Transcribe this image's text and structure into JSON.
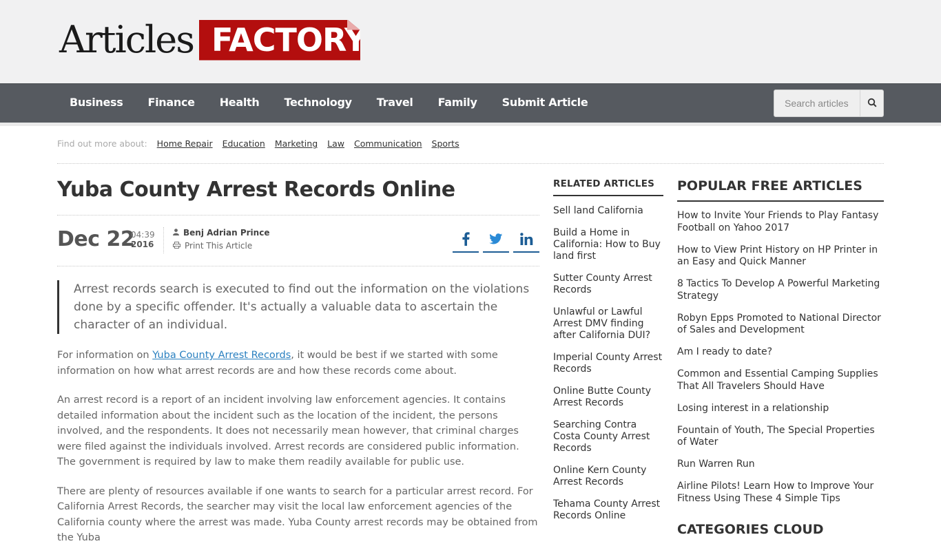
{
  "logo": {
    "articles": "Articles",
    "factory": "FACTORY"
  },
  "nav": {
    "items": [
      "Business",
      "Finance",
      "Health",
      "Technology",
      "Travel",
      "Family",
      "Submit Article"
    ],
    "search_placeholder": "Search articles"
  },
  "topics": {
    "label": "Find out more about:",
    "links": [
      "Home Repair",
      "Education",
      "Marketing",
      "Law",
      "Communication",
      "Sports"
    ]
  },
  "article": {
    "title": "Yuba County Arrest Records Online",
    "date": "Dec 22",
    "time": "04:39",
    "year": "2016",
    "author": "Benj Adrian Prince",
    "print_label": "Print This Article",
    "quote": "Arrest records search is executed to find out the information on the violations done by a specific offender. It's actually a valuable data to ascertain the character of an individual.",
    "p1_pre": "For information on ",
    "p1_link": "Yuba County Arrest Records",
    "p1_post": ", it would be best if we started with some information on how what arrest records are and how these records come about.",
    "p2": "An arrest record is a report of an incident involving law enforcement agencies. It contains detailed information about the incident such as the location of the incident, the persons involved, and the respondents. It does not necessarily mean however, that criminal charges were filed against the individuals involved. Arrest records are considered public information. The government is required by law to make them readily available for public use.",
    "p3": "There are plenty of resources available if one wants to search for a particular arrest record. For California Arrest Records, the searcher may visit the local law enforcement agencies of the California county where the arrest was made. Yuba County arrest records may be obtained from the Yuba"
  },
  "share_icons": [
    "facebook-icon",
    "twitter-icon",
    "linkedin-icon"
  ],
  "related": {
    "title": "RELATED ARTICLES",
    "items": [
      "Sell land California",
      "Build a Home in California: How to Buy land first",
      "Sutter County Arrest Records",
      "Unlawful or Lawful Arrest DMV finding after California DUI?",
      "Imperial County Arrest Records",
      "Online Butte County Arrest Records",
      "Searching Contra Costa County Arrest Records",
      "Online Kern County Arrest Records",
      "Tehama County Arrest Records Online"
    ]
  },
  "popular": {
    "title": "POPULAR FREE ARTICLES",
    "items": [
      "How to Invite Your Friends to Play Fantasy Football on Yahoo 2017",
      "How to View Print History on HP Printer in an Easy and Quick Manner",
      "8 Tactics To Develop A Powerful Marketing Strategy",
      "Robyn Epps Promoted to National Director of Sales and Development",
      "Am I ready to date?",
      "Common and Essential Camping Supplies That All Travelers Should Have",
      "Losing interest in a relationship",
      "Fountain of Youth, The Special Properties of Water",
      "Run Warren Run",
      "Airline Pilots! Learn How to Improve Your Fitness Using These 4 Simple Tips"
    ]
  },
  "categories_title": "CATEGORIES CLOUD",
  "colors": {
    "brand_red": "#b30e0e",
    "nav_bg": "#565a60",
    "share_blue": "#1c5d95",
    "link_blue": "#2a80c0"
  }
}
